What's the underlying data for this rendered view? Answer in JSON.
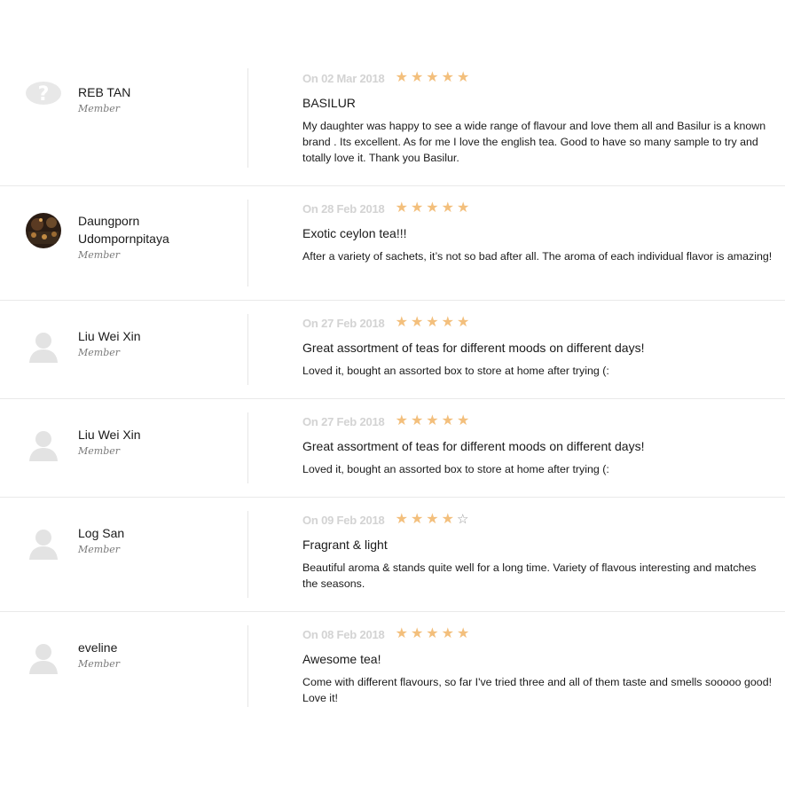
{
  "reviews": [
    {
      "name": "REB TAN",
      "role": "Member",
      "avatar": "question-mark-avatar",
      "date": "On 02 Mar 2018",
      "rating": 5,
      "title": "BASILUR",
      "text": "My daughter was happy to see a wide range of flavour and love them all and Basilur is a known brand . Its excellent. As for me I love the english tea. Good to have so many sample to try and totally love it. Thank you Basilur."
    },
    {
      "name": "Daungporn Udompornpitaya",
      "role": "Member",
      "avatar": "photo-avatar",
      "date": "On 28 Feb 2018",
      "rating": 5,
      "title": "Exotic ceylon tea!!!",
      "text": "After a variety of sachets, it’s not so bad after all. The aroma of each individual flavor is amazing!"
    },
    {
      "name": "Liu Wei Xin",
      "role": "Member",
      "avatar": "default-user-avatar",
      "date": "On 27 Feb 2018",
      "rating": 5,
      "title": "Great assortment of teas for different moods on different days!",
      "text": "Loved it, bought an assorted box to store at home after trying (:"
    },
    {
      "name": "Liu Wei Xin",
      "role": "Member",
      "avatar": "default-user-avatar",
      "date": "On 27 Feb 2018",
      "rating": 5,
      "title": "Great assortment of teas for different moods on different days!",
      "text": "Loved it, bought an assorted box to store at home after trying (:"
    },
    {
      "name": "Log San",
      "role": "Member",
      "avatar": "default-user-avatar",
      "date": "On 09 Feb 2018",
      "rating": 4,
      "title": "Fragrant & light",
      "text": "Beautiful aroma & stands quite well for a long time. Variety of flavous interesting and matches the seasons."
    },
    {
      "name": "eveline",
      "role": "Member",
      "avatar": "default-user-avatar",
      "date": "On 08 Feb 2018",
      "rating": 5,
      "title": "Awesome tea!",
      "text": "Come with different flavours, so far I've tried three and all of them taste and smells sooooo good! Love it!"
    }
  ],
  "colors": {
    "star_filled": "#f3bf7c",
    "star_empty": "#999999",
    "date": "#d3d3d3",
    "divider": "#e9e9e9"
  }
}
